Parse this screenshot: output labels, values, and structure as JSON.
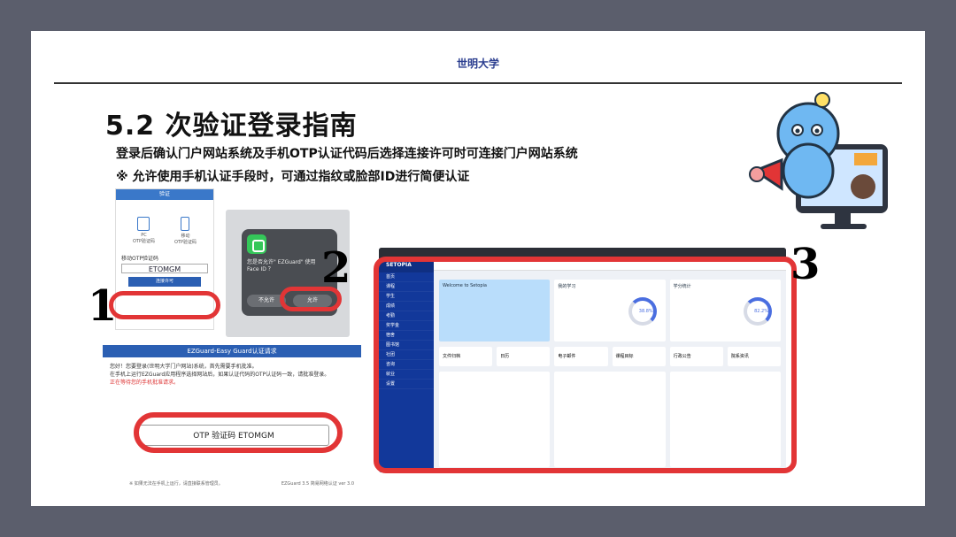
{
  "header": {
    "university": "世明大学"
  },
  "title": "5.2 次验证登录指南",
  "subtitles": [
    "登录后确认门户网站系统及手机OTP认证代码后选择连接许可时可连接门户网站系统",
    "※ 允许使用手机认证手段时，可通过指纹或脸部ID进行简便认证"
  ],
  "steps": [
    "1",
    "2",
    "3"
  ],
  "panel_otp": {
    "header": "验证",
    "pc_label": "PC",
    "pc_sub": "OTP验证码",
    "mobile_label": "移动",
    "mobile_sub": "OTP验证码",
    "section_label": "移动OTP验证码",
    "otp_code": "ETOMGM",
    "approve_button": "连接许可"
  },
  "panel_faceid": {
    "prompt_line1": "您是否允许\" EZGuard\" 使用",
    "prompt_line2": "Face ID ？",
    "deny_button": "不允许",
    "allow_button": "允许"
  },
  "panel_ezguard": {
    "header": "EZGuard-Easy Guard认证请求",
    "message_line1": "您好！您要登录(世明大学门户网站)系统，首先需要手机批准。",
    "message_line2": "在手机上运行EZGuard应用程序选择网站后，如果认证代码的OTP认证码一致，请批准登录。",
    "warning": "正在等待您的手机批准请求。",
    "otp_button": "OTP 验证码 ETOMGM",
    "footer_left": "※ 如果无法在手机上运行，请直接联系管理员。",
    "footer_right": "EZGuard 3.5 简易网络认证 ver 3.0"
  },
  "dashboard": {
    "brand": "SETOPIA",
    "sidebar_items": [
      "首页",
      "课程",
      "学生",
      "成绩",
      "考勤",
      "奖学金",
      "宿舍",
      "图书馆",
      "社团",
      "咨询",
      "就业",
      "设置"
    ],
    "card_titles": [
      "Welcome to Setopia",
      "我的学习",
      "学分统计"
    ],
    "gauge_values": [
      "38.8%",
      "82.2%"
    ],
    "small_titles": [
      "文件归档",
      "日历",
      "电子邮件",
      "课程目标",
      "行政公告",
      "院系资讯"
    ]
  },
  "colors": {
    "accent": "#2b5fb3",
    "highlight": "#e23536",
    "sidebar": "#12389a"
  }
}
